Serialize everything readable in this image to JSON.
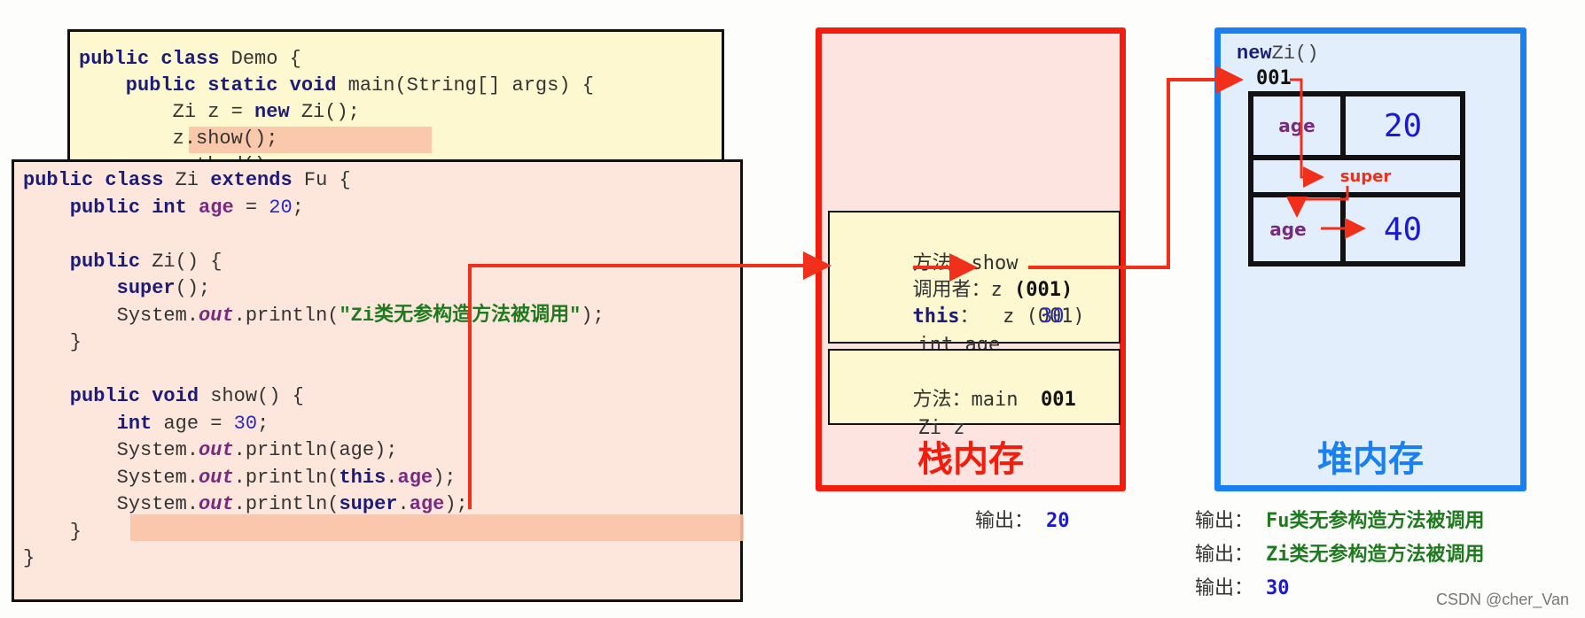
{
  "demo_code": {
    "lines": [
      [
        {
          "t": "public class ",
          "c": "kw"
        },
        {
          "t": "Demo {",
          "c": ""
        }
      ],
      [
        {
          "t": "    public static void ",
          "c": "kw"
        },
        {
          "t": "main(String[] args) {",
          "c": ""
        }
      ],
      [
        {
          "t": "        Zi z = ",
          "c": ""
        },
        {
          "t": "new ",
          "c": "kw"
        },
        {
          "t": "Zi();",
          "c": ""
        }
      ],
      [
        {
          "t": "        z.show();",
          "c": ""
        }
      ],
      [
        {
          "t": "        method();",
          "c": ""
        }
      ]
    ],
    "highlighted_line": 3
  },
  "zi_code": {
    "lines": [
      [
        {
          "t": "public class ",
          "c": "kw"
        },
        {
          "t": "Zi ",
          "c": ""
        },
        {
          "t": "extends ",
          "c": "kw"
        },
        {
          "t": "Fu {",
          "c": ""
        }
      ],
      [
        {
          "t": "    public int ",
          "c": "kw"
        },
        {
          "t": "age",
          "c": "fld"
        },
        {
          "t": " = ",
          "c": ""
        },
        {
          "t": "20",
          "c": "num"
        },
        {
          "t": ";",
          "c": ""
        }
      ],
      [],
      [
        {
          "t": "    public ",
          "c": "kw"
        },
        {
          "t": "Zi() {",
          "c": ""
        }
      ],
      [
        {
          "t": "        super",
          "c": "kw"
        },
        {
          "t": "();",
          "c": ""
        }
      ],
      [
        {
          "t": "        System.",
          "c": ""
        },
        {
          "t": "out",
          "c": "fldi"
        },
        {
          "t": ".println(",
          "c": ""
        },
        {
          "t": "\"Zi类无参构造方法被调用\"",
          "c": "str"
        },
        {
          "t": ");",
          "c": ""
        }
      ],
      [
        {
          "t": "    }",
          "c": ""
        }
      ],
      [],
      [
        {
          "t": "    public void ",
          "c": "kw"
        },
        {
          "t": "show() {",
          "c": ""
        }
      ],
      [
        {
          "t": "        int ",
          "c": "kw"
        },
        {
          "t": "age = ",
          "c": ""
        },
        {
          "t": "30",
          "c": "num"
        },
        {
          "t": ";",
          "c": ""
        }
      ],
      [
        {
          "t": "        System.",
          "c": ""
        },
        {
          "t": "out",
          "c": "fldi"
        },
        {
          "t": ".println(age);",
          "c": ""
        }
      ],
      [
        {
          "t": "        System.",
          "c": ""
        },
        {
          "t": "out",
          "c": "fldi"
        },
        {
          "t": ".println(",
          "c": ""
        },
        {
          "t": "this",
          "c": "kw"
        },
        {
          "t": ".",
          "c": ""
        },
        {
          "t": "age",
          "c": "fld"
        },
        {
          "t": ");",
          "c": ""
        }
      ],
      [
        {
          "t": "        System.",
          "c": ""
        },
        {
          "t": "out",
          "c": "fldi"
        },
        {
          "t": ".println(",
          "c": ""
        },
        {
          "t": "super",
          "c": "kw"
        },
        {
          "t": ".",
          "c": ""
        },
        {
          "t": "age",
          "c": "fld"
        },
        {
          "t": ");",
          "c": ""
        }
      ],
      [
        {
          "t": "    }",
          "c": ""
        }
      ],
      [
        {
          "t": "}",
          "c": ""
        }
      ]
    ],
    "highlighted_line": 12
  },
  "stack": {
    "label": "栈内存",
    "label_color": "#f21d0d",
    "frames": [
      {
        "method_label": "方法：",
        "method_name": "show",
        "caller_label": "调用者：",
        "caller_value": "z (001)",
        "this_keyword": "this",
        "this_value": "：  z (001)",
        "local_name": "int age",
        "local_value": "30"
      },
      {
        "method_label": "方法：",
        "method_name": "main",
        "local_name": "Zi z",
        "local_value": "001"
      }
    ]
  },
  "heap": {
    "label": "堆内存",
    "label_color": "#1880f0",
    "object_header_kw": "new",
    "object_header_rest": "Zi()",
    "address": "001",
    "fields": {
      "zi_field_name": "age",
      "zi_field_value": "20",
      "super_label": "super",
      "fu_field_name": "age",
      "fu_field_value": "40"
    }
  },
  "outputs": {
    "stack_side": [
      {
        "label": "输出：",
        "value": "20",
        "color": "blue"
      }
    ],
    "heap_side": [
      {
        "label": "输出：",
        "value": "Fu类无参构造方法被调用",
        "color": "green"
      },
      {
        "label": "输出：",
        "value": "Zi类无参构造方法被调用",
        "color": "green"
      },
      {
        "label": "输出：",
        "value": "30",
        "color": "blue"
      }
    ]
  },
  "watermark": "CSDN @cher_Van"
}
